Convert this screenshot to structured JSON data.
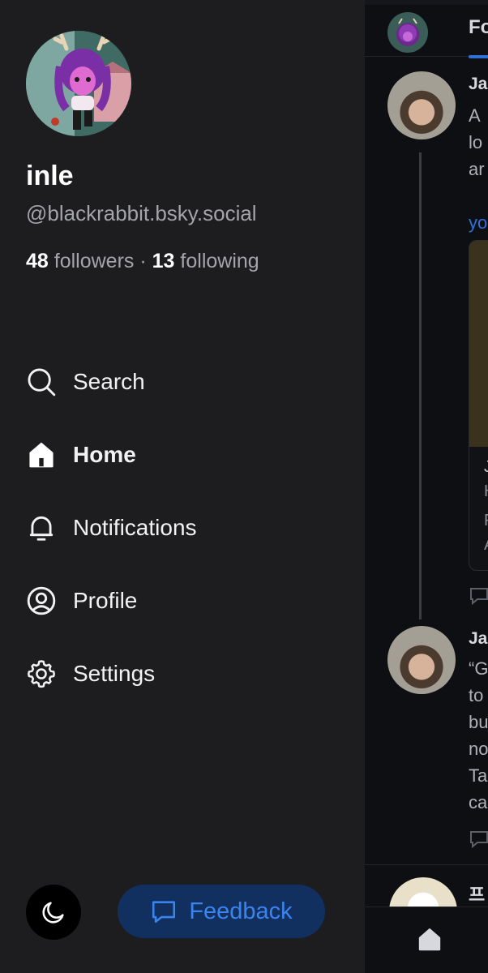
{
  "profile": {
    "display_name": "inle",
    "handle": "@blackrabbit.bsky.social",
    "followers_count": "48",
    "followers_label": "followers",
    "separator": "·",
    "following_count": "13",
    "following_label": "following"
  },
  "nav": {
    "items": [
      {
        "label": "Search",
        "icon": "search-icon"
      },
      {
        "label": "Home",
        "icon": "home-icon",
        "active": true
      },
      {
        "label": "Notifications",
        "icon": "bell-icon"
      },
      {
        "label": "Profile",
        "icon": "profile-icon"
      },
      {
        "label": "Settings",
        "icon": "gear-icon"
      }
    ]
  },
  "footer": {
    "theme_icon": "moon-icon",
    "feedback_label": "Feedback",
    "feedback_icon": "message-icon"
  },
  "feed": {
    "tab_label": "Fo",
    "posts": [
      {
        "author": "Ja",
        "lines": [
          "A",
          "lo",
          "ar"
        ],
        "link": "yo",
        "embed_lines": [
          "J",
          "H",
          "F",
          "A"
        ]
      },
      {
        "author": "Ja",
        "lines": [
          "“G",
          "to",
          "bu",
          "no",
          "Ta",
          "ca"
        ]
      },
      {
        "author": "프"
      }
    ]
  },
  "colors": {
    "drawer_bg": "#1d1c1f",
    "accent": "#3a84ef",
    "feedback_bg": "#12305f"
  }
}
